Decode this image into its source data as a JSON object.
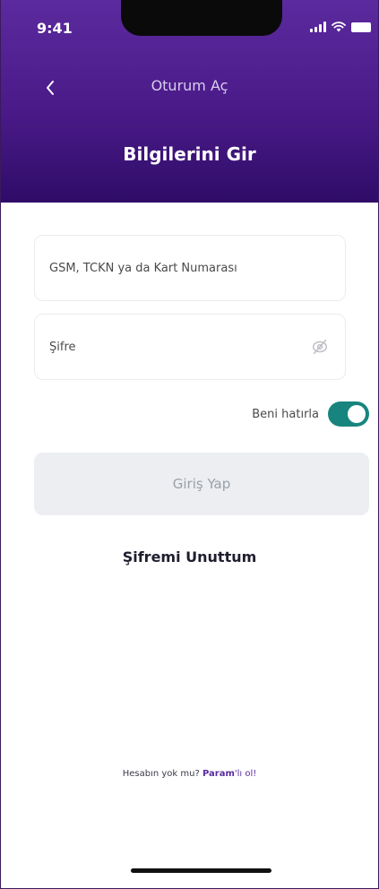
{
  "status_bar": {
    "time": "9:41",
    "signal_icon": "signal-bars-icon",
    "wifi_icon": "wifi-icon",
    "battery_icon": "battery-icon"
  },
  "nav": {
    "back_icon": "chevron-left-icon",
    "title": "Oturum Aç"
  },
  "page": {
    "title": "Bilgilerini Gir"
  },
  "form": {
    "id_field": {
      "value": "",
      "placeholder": "GSM, TCKN ya da Kart Numarası"
    },
    "password_field": {
      "value": "",
      "placeholder": "Şifre",
      "visibility_icon": "eye-slash-icon"
    },
    "remember_me": {
      "label": "Beni hatırla",
      "enabled": true
    },
    "login_button_label": "Giriş Yap"
  },
  "forgot_password_label": "Şifremi Unuttum",
  "signup": {
    "prefix": "Hesabın yok mu? ",
    "brand": "Param",
    "suffix": "'lı ol!"
  },
  "colors": {
    "header_top": "#5b2a9e",
    "header_bottom": "#2f0c68",
    "toggle_on": "#17857e",
    "brand_purple": "#5a2aa0",
    "disabled_button": "#eceef1"
  }
}
